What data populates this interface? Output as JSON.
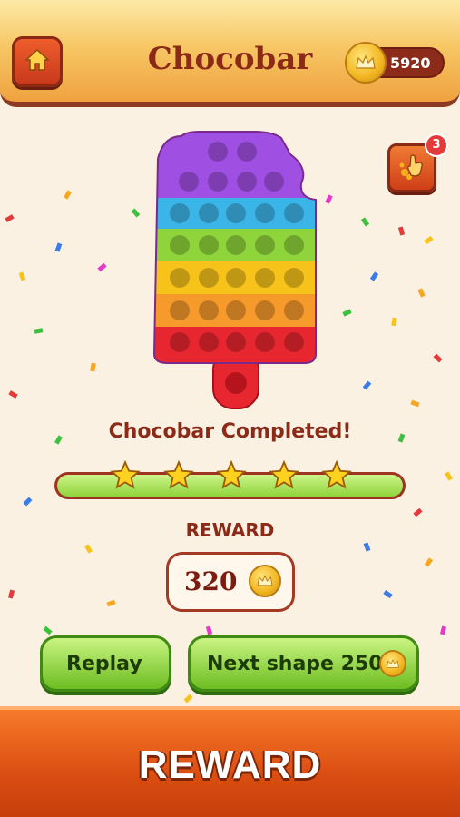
{
  "header": {
    "title": "Chocobar",
    "coins": "5920"
  },
  "hint": {
    "badge_count": "3"
  },
  "result": {
    "completed_text": "Chocobar Completed!",
    "stars": 5,
    "progress": 1.0
  },
  "reward": {
    "label": "REWARD",
    "amount": "320"
  },
  "buttons": {
    "replay": "Replay",
    "next_shape": "Next shape 250"
  },
  "bottom": {
    "reward_button": "REWARD"
  },
  "colors": {
    "purple": "#a04fe3",
    "blue": "#3bb4e8",
    "green": "#8fd43a",
    "yellow": "#f7c21a",
    "orange": "#f59a2b",
    "red": "#e8262f",
    "accent": "#8b2a17"
  },
  "icons": [
    "home-icon",
    "crown-coin-icon",
    "hint-hand-icon",
    "star-icon"
  ]
}
